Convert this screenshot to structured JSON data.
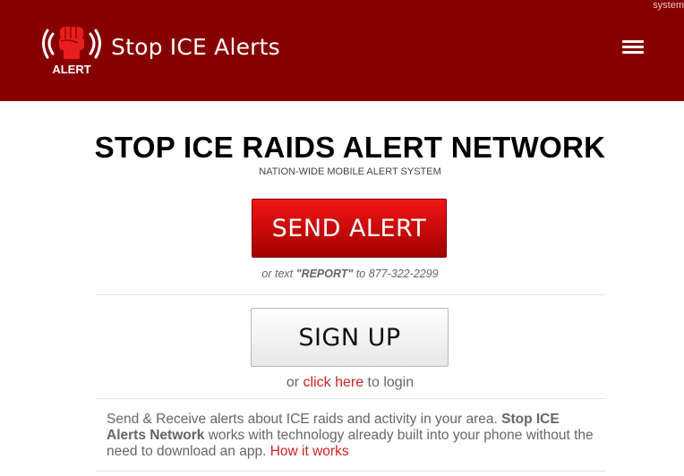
{
  "header": {
    "corner_text": "system",
    "logo_text": "ALERT",
    "brand": "Stop ICE Alerts",
    "menu_icon": "hamburger-menu-icon"
  },
  "main": {
    "title": "STOP ICE RAIDS ALERT NETWORK",
    "subtitle": "NATION-WIDE MOBILE ALERT SYSTEM",
    "send_button": "SEND ALERT",
    "text_prefix": "or text ",
    "text_keyword": "\"REPORT\"",
    "text_suffix": " to 877-322-2299",
    "signup_button": "SIGN UP",
    "login_prefix": "or ",
    "login_link": "click here",
    "login_suffix": " to login",
    "desc_part1": "Send & Receive alerts about ICE raids and activity in your area. ",
    "desc_bold": "Stop ICE Alerts Network",
    "desc_part2": " works with technology already built into your phone without the need to download an app. ",
    "desc_link": "How it works"
  },
  "colors": {
    "header_bg": "#870000",
    "send_button_top": "#f31515",
    "send_button_bottom": "#a10000",
    "link": "#cc2222"
  }
}
